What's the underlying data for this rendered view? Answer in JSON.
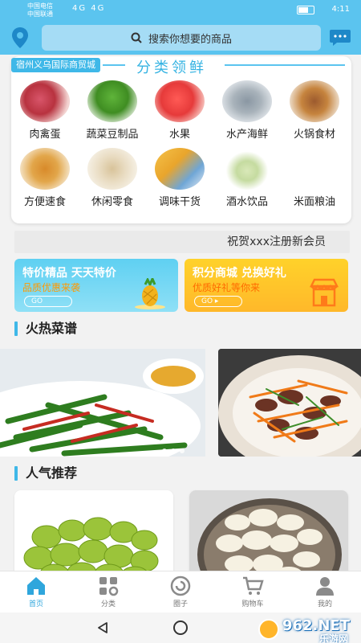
{
  "status_bar": {
    "carrier_line1": "中国电信",
    "carrier_line2": "中国联通",
    "signal": "4G 4G",
    "time": "4:11"
  },
  "header": {
    "search_placeholder": "搜索你想要的商品",
    "colors": {
      "bar": "#5bc4ef",
      "search_bg": "#a5dcf5"
    }
  },
  "category": {
    "market_name": "宿州义乌国际商贸城",
    "title": "分类领鲜",
    "items": [
      {
        "label": "肉禽蛋",
        "icon": "meat-image"
      },
      {
        "label": "蔬菜豆制品",
        "icon": "vegetable-image"
      },
      {
        "label": "水果",
        "icon": "fruit-image"
      },
      {
        "label": "水产海鲜",
        "icon": "seafood-image"
      },
      {
        "label": "火锅食材",
        "icon": "hotpot-image"
      },
      {
        "label": "方便速食",
        "icon": "instant-food-image"
      },
      {
        "label": "休闲零食",
        "icon": "snack-image"
      },
      {
        "label": "调味干货",
        "icon": "seasoning-image"
      },
      {
        "label": "酒水饮品",
        "icon": "drink-image"
      },
      {
        "label": "米面粮油",
        "icon": "grain-image"
      }
    ]
  },
  "notice": {
    "text": "祝贺xxx注册新会员"
  },
  "promos": [
    {
      "title": "特价精品  天天特价",
      "subtitle": "品质优惠来袭",
      "button": "GO",
      "icon": "pineapple-icon"
    },
    {
      "title": "积分商城  兑换好礼",
      "subtitle": "优质好礼等你来",
      "button": "GO ▸",
      "icon": "store-icon"
    }
  ],
  "sections": {
    "recipes": "火热菜谱",
    "popular": "人气推荐"
  },
  "tabs": [
    {
      "label": "首页",
      "icon": "home-icon",
      "active": true
    },
    {
      "label": "分类",
      "icon": "category-icon",
      "active": false
    },
    {
      "label": "圈子",
      "icon": "circle-icon",
      "active": false
    },
    {
      "label": "购物车",
      "icon": "cart-icon",
      "active": false
    },
    {
      "label": "我的",
      "icon": "user-icon",
      "active": false
    }
  ],
  "watermark": {
    "text": "962.NET",
    "sub": "乐游网"
  }
}
